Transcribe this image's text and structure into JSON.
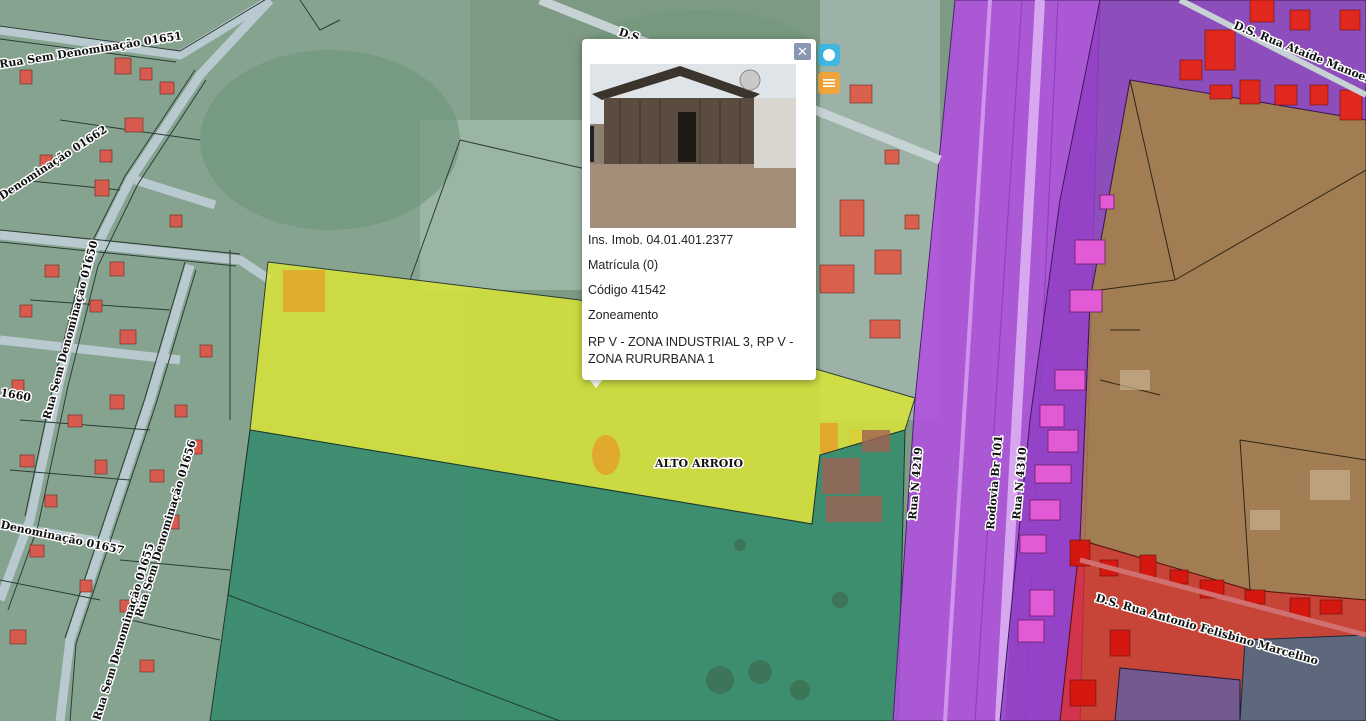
{
  "map": {
    "streets": {
      "s1": "Rua Sem Denominação 01651",
      "s2": "Denominação 01662",
      "s3": "Rua Sem Denominação 01650",
      "s4": "1660",
      "s5": "Rua Sem Denominação 01656",
      "s6": "Denominação 01657",
      "s7": "Rua Sem Denominação 01655",
      "s8": "D.S.",
      "s9": "D.S. Rua Ataíde Manoel",
      "s10": "Rua N 4219",
      "s11": "Rodovia Br 101",
      "s12": "Rua N 4310",
      "s13": "D.S. Rua Antonio Felisbino Marcelino"
    },
    "place_label": "ALTO ARROIO"
  },
  "popup": {
    "close_label": "✕",
    "inscricao": "Ins. Imob. 04.01.401.2377",
    "matricula": "Matrícula (0)",
    "codigo": "Código 41542",
    "zoneamento_title": "Zoneamento",
    "zoneamento_line1": "RP V - ZONA INDUSTRIAL 3, RP V -",
    "zoneamento_line2": "ZONA RURURBANA 1"
  },
  "colors": {
    "zone_yellow": "#d8e536",
    "zone_teal": "#2f8a6a",
    "zone_purple": "#b24fe0",
    "zone_brown": "#a8784a",
    "zone_red": "#e0281f",
    "info_button": "#3fb7e0",
    "list_button": "#f0a43a"
  },
  "icons": {
    "info": "info-circle-icon",
    "list": "list-icon",
    "close": "close-icon"
  }
}
